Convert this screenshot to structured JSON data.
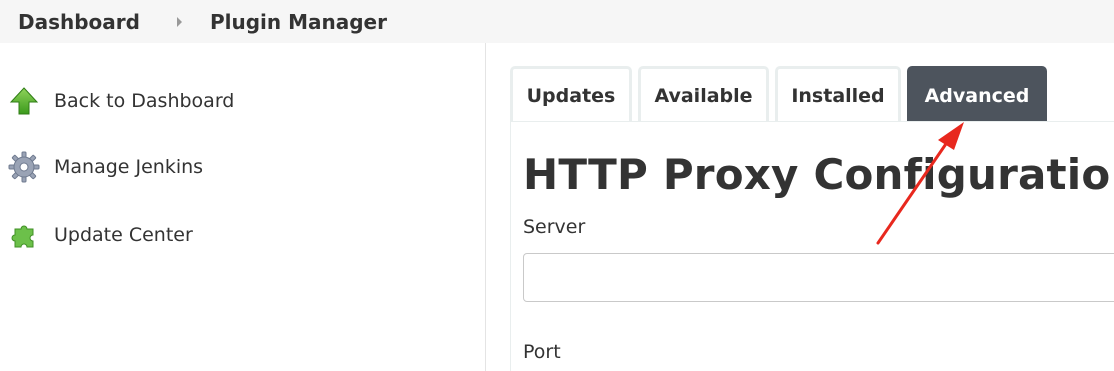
{
  "breadcrumb": {
    "items": [
      {
        "label": "Dashboard"
      },
      {
        "label": "Plugin Manager"
      }
    ]
  },
  "sidebar": {
    "items": [
      {
        "label": "Back to Dashboard",
        "icon": "up-arrow-icon"
      },
      {
        "label": "Manage Jenkins",
        "icon": "gear-icon"
      },
      {
        "label": "Update Center",
        "icon": "puzzle-icon"
      }
    ]
  },
  "tabs": [
    {
      "label": "Updates",
      "active": false
    },
    {
      "label": "Available",
      "active": false
    },
    {
      "label": "Installed",
      "active": false
    },
    {
      "label": "Advanced",
      "active": true
    }
  ],
  "main": {
    "heading": "HTTP Proxy Configuration",
    "server_label": "Server",
    "server_value": "",
    "port_label": "Port"
  },
  "colors": {
    "active_tab_bg": "#4d545d",
    "breadcrumb_bg": "#f6f6f6",
    "annotation_arrow": "#e8281e"
  }
}
